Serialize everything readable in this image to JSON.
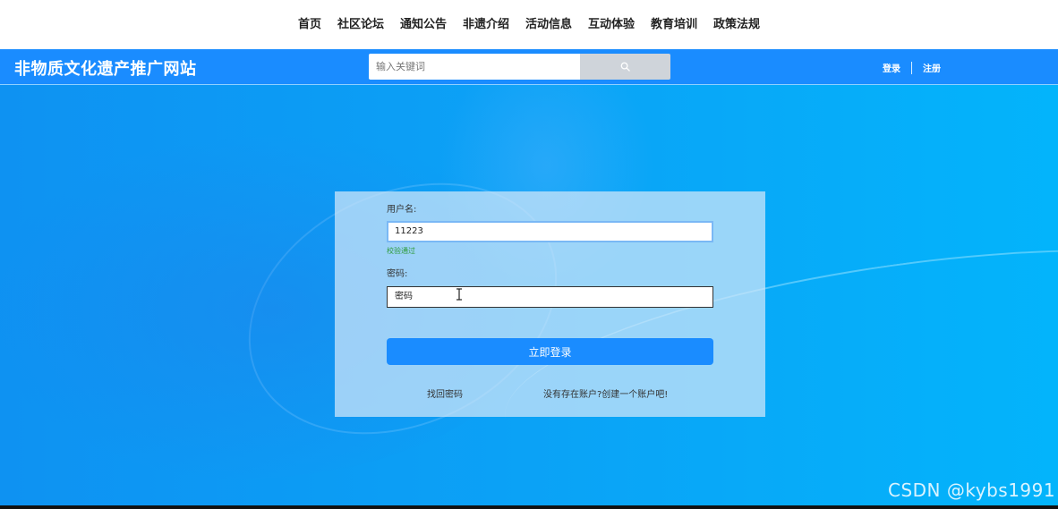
{
  "nav": {
    "items": [
      "首页",
      "社区论坛",
      "通知公告",
      "非遗介绍",
      "活动信息",
      "互动体验",
      "教育培训",
      "政策法规"
    ]
  },
  "header": {
    "site_title": "非物质文化遗产推广网站",
    "search": {
      "placeholder": "输入关键词",
      "value": ""
    },
    "search_icon": "search-icon",
    "login_link": "登录",
    "register_link": "注册"
  },
  "login": {
    "username_label": "用户名:",
    "username_value": "11223",
    "validation_message": "校验通过",
    "password_label": "密码:",
    "password_value": "密码",
    "submit_label": "立即登录",
    "forgot_password": "找回密码",
    "create_account": "没有存在账户?创建一个账户吧!"
  },
  "watermark": "CSDN @kybs1991",
  "colors": {
    "header_bg": "#1a8cff",
    "button_bg": "#1a8cff",
    "validation_text": "#2e9b3a",
    "background_gradient": [
      "#0e92f2",
      "#03b4fb"
    ]
  }
}
